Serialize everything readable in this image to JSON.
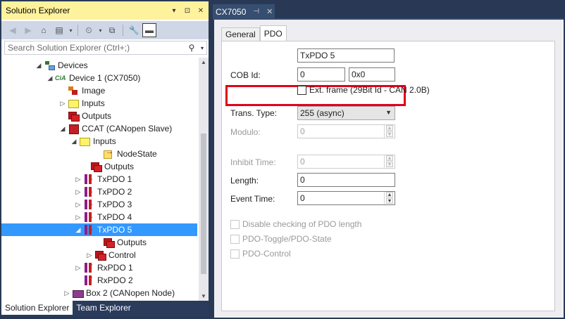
{
  "solution_explorer": {
    "title": "Solution Explorer",
    "title_buttons": [
      "▾",
      "⊡",
      "✕"
    ],
    "search_placeholder": "Search Solution Explorer (Ctrl+;)",
    "tree": [
      {
        "label": "Devices",
        "expander": "◢",
        "icon": "devices"
      },
      {
        "label": "Device 1 (CX7050)",
        "expander": "◢",
        "icon": "cia",
        "icon_text": "CiA"
      },
      {
        "label": "Image",
        "expander": "",
        "icon": "image"
      },
      {
        "label": "Inputs",
        "expander": "▷",
        "icon": "inputs"
      },
      {
        "label": "Outputs",
        "expander": "",
        "icon": "outputs"
      },
      {
        "label": "CCAT (CANopen Slave)",
        "expander": "◢",
        "icon": "ccat"
      },
      {
        "label": "Inputs",
        "expander": "◢",
        "icon": "inputs"
      },
      {
        "label": "NodeState",
        "expander": "",
        "icon": "node"
      },
      {
        "label": "Outputs",
        "expander": "",
        "icon": "outputs"
      },
      {
        "label": "TxPDO 1",
        "expander": "▷",
        "icon": "txpdo"
      },
      {
        "label": "TxPDO 2",
        "expander": "▷",
        "icon": "txpdo"
      },
      {
        "label": "TxPDO 3",
        "expander": "▷",
        "icon": "txpdo"
      },
      {
        "label": "TxPDO 4",
        "expander": "▷",
        "icon": "txpdo"
      },
      {
        "label": "TxPDO 5",
        "expander": "◢",
        "icon": "txpdo"
      },
      {
        "label": "Outputs",
        "expander": "",
        "icon": "outputs"
      },
      {
        "label": "Control",
        "expander": "▷",
        "icon": "outputs"
      },
      {
        "label": "RxPDO 1",
        "expander": "▷",
        "icon": "rxpdo"
      },
      {
        "label": "RxPDO 2",
        "expander": "",
        "icon": "rxpdo"
      },
      {
        "label": "Box 2 (CANopen Node)",
        "expander": "▷",
        "icon": "box"
      }
    ],
    "bottom_tabs": {
      "solution": "Solution Explorer",
      "team": "Team Explorer"
    }
  },
  "document": {
    "tab_title": "CX7050",
    "pin_glyph": "⊣",
    "close_glyph": "✕",
    "tabs": {
      "general": "General",
      "pdo": "PDO"
    },
    "pdo": {
      "name": "TxPDO 5",
      "cob_label": "COB Id:",
      "cob_value": "0",
      "cob_hex": "0x0",
      "ext_frame": "Ext. frame (29Bit Id - CAN 2.0B)",
      "trans_label": "Trans. Type:",
      "trans_value": "255 (async)",
      "modulo_label": "Modulo:",
      "modulo_value": "0",
      "inhibit_label": "Inhibit Time:",
      "inhibit_value": "0",
      "length_label": "Length:",
      "length_value": "0",
      "event_label": "Event Time:",
      "event_value": "0",
      "disable_check": "Disable checking of PDO length",
      "toggle_state": "PDO-Toggle/PDO-State",
      "pdo_control": "PDO-Control"
    }
  },
  "colors": {
    "title_bar": "#fff29d",
    "selection": "#3399ff",
    "highlight": "#e0001b",
    "frame": "#293955"
  }
}
